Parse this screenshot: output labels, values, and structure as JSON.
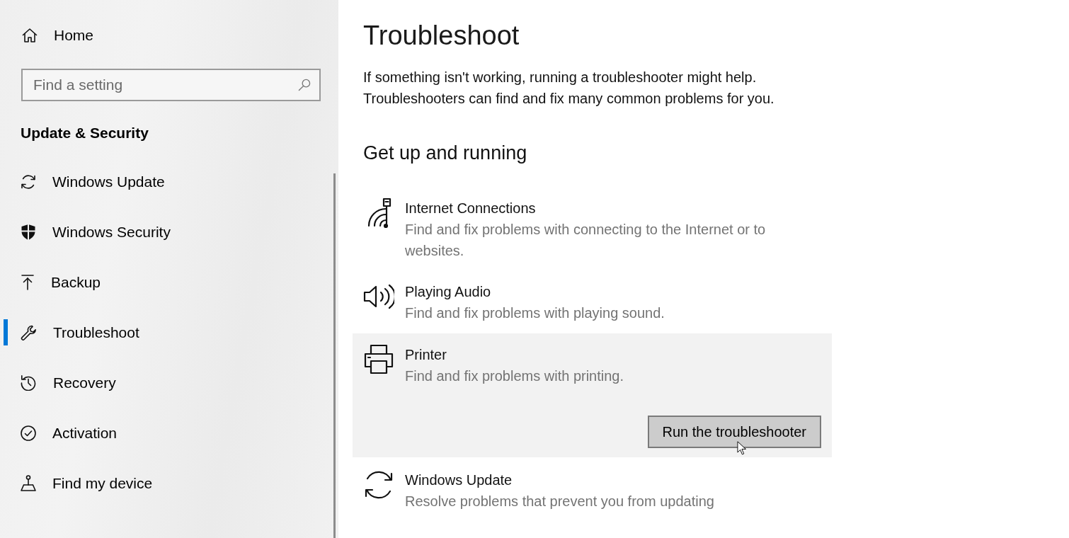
{
  "sidebar": {
    "home": {
      "label": "Home"
    },
    "search": {
      "placeholder": "Find a setting"
    },
    "section_title": "Update & Security",
    "items": [
      {
        "label": "Windows Update",
        "selected": false
      },
      {
        "label": "Windows Security",
        "selected": false
      },
      {
        "label": "Backup",
        "selected": false
      },
      {
        "label": "Troubleshoot",
        "selected": true
      },
      {
        "label": "Recovery",
        "selected": false
      },
      {
        "label": "Activation",
        "selected": false
      },
      {
        "label": "Find my device",
        "selected": false
      }
    ]
  },
  "main": {
    "title": "Troubleshoot",
    "intro": "If something isn't working, running a troubleshooter might help. Troubleshooters can find and fix many common problems for you.",
    "section_title": "Get up and running",
    "troubleshooters": [
      {
        "name": "Internet Connections",
        "description": "Find and fix problems with connecting to the Internet or to websites.",
        "expanded": false
      },
      {
        "name": "Playing Audio",
        "description": "Find and fix problems with playing sound.",
        "expanded": false
      },
      {
        "name": "Printer",
        "description": "Find and fix problems with printing.",
        "expanded": true,
        "button": "Run the troubleshooter"
      },
      {
        "name": "Windows Update",
        "description": "Resolve problems that prevent you from updating",
        "expanded": false
      }
    ]
  }
}
